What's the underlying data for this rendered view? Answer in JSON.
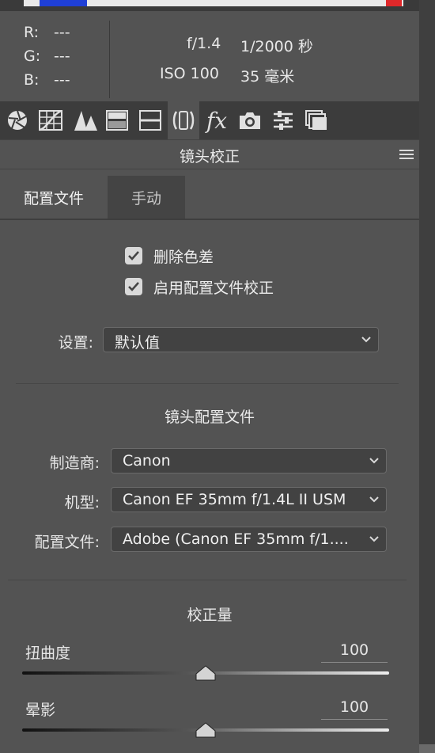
{
  "info": {
    "r_label": "R:",
    "r_value": "---",
    "g_label": "G:",
    "g_value": "---",
    "b_label": "B:",
    "b_value": "---",
    "aperture": "f/1.4",
    "shutter": "1/2000 秒",
    "iso": "ISO 100",
    "focal": "35 毫米"
  },
  "toolbar": {
    "fx_label": "fx",
    "tools": [
      "basic-icon",
      "tone-curve-icon",
      "detail-icon",
      "hsl-icon",
      "split-toning-icon",
      "lens-corrections-icon",
      "effects-icon",
      "camera-calibration-icon",
      "presets-icon",
      "snapshots-icon"
    ],
    "active": "lens-corrections-icon"
  },
  "panel": {
    "title": "镜头校正"
  },
  "tabs": {
    "profile": "配置文件",
    "manual": "手动"
  },
  "checkboxes": {
    "remove_ca": {
      "label": "删除色差",
      "checked": true
    },
    "enable_profile": {
      "label": "启用配置文件校正",
      "checked": true
    }
  },
  "setup": {
    "label": "设置:",
    "value": "默认值"
  },
  "lens_profile": {
    "title": "镜头配置文件",
    "make_label": "制造商:",
    "make_value": "Canon",
    "model_label": "机型:",
    "model_value": "Canon EF 35mm f/1.4L II USM",
    "profile_label": "配置文件:",
    "profile_value": "Adobe (Canon EF 35mm f/1...."
  },
  "amount": {
    "title": "校正量",
    "distortion_label": "扭曲度",
    "distortion_value": "100",
    "vignetting_label": "晕影",
    "vignetting_value": "100"
  },
  "colors": {
    "panel_bg": "#535353",
    "toolbar_bg": "#3c3c3c",
    "inactive_tab_bg": "#444444",
    "histogram_blue": "#1f3fd6",
    "histogram_red": "#e0282a"
  }
}
